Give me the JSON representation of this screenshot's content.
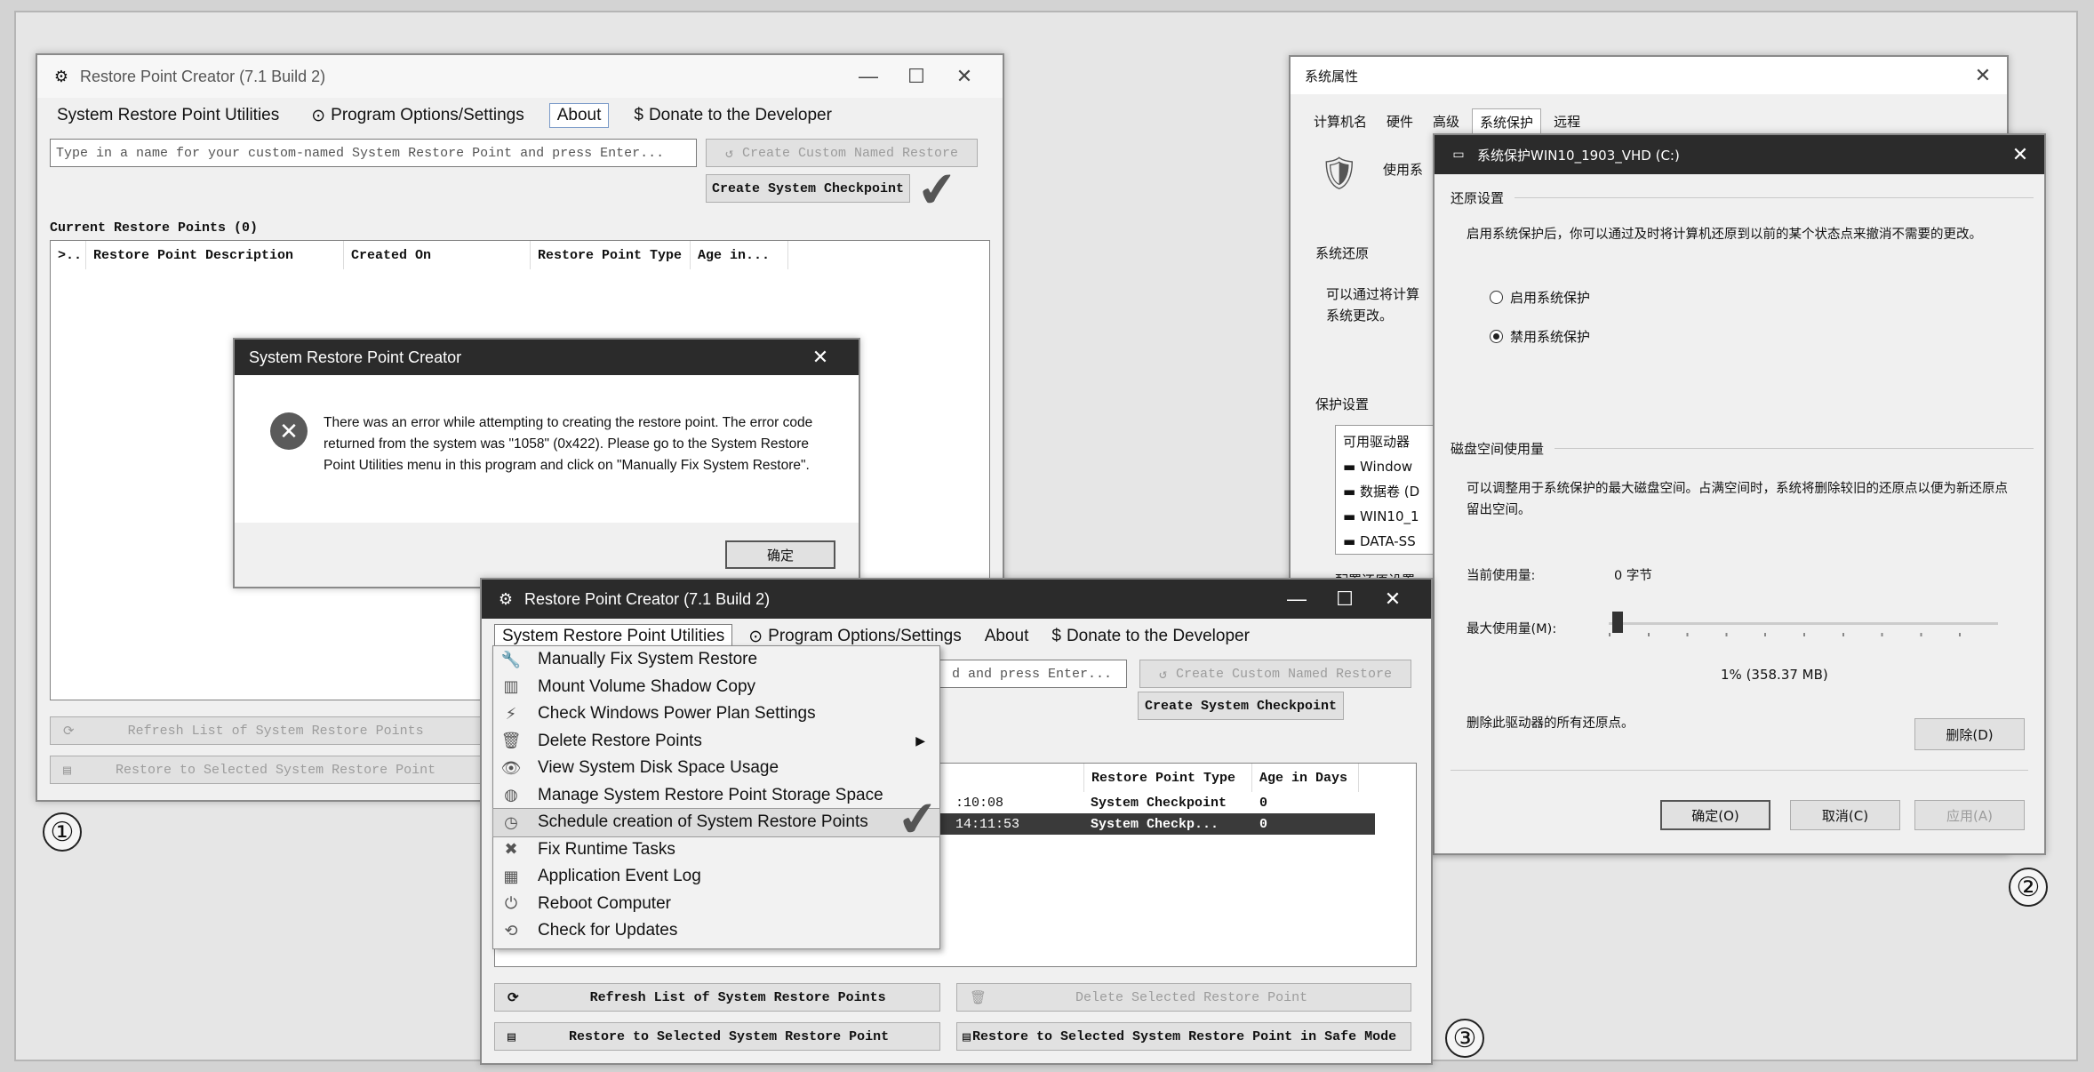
{
  "colors": {
    "background": "#d3d3d3",
    "titlebar_dark": "#2b2b2b",
    "selection": "#3a3a3a",
    "error_icon": "#5a5a5a"
  },
  "win1": {
    "title": "Restore Point Creator (7.1 Build 2)",
    "menu": [
      "System Restore Point Utilities",
      "Program Options/Settings",
      "About",
      "Donate to the Developer"
    ],
    "input_placeholder": "Type in a name for your custom-named System Restore Point and press Enter...",
    "btn_custom": "Create Custom Named Restore",
    "btn_checkpoint": "Create System Checkpoint",
    "current_label": "Current Restore Points (0)",
    "columns": [
      ">..",
      "Restore Point Description",
      "Created On",
      "Restore Point Type",
      "Age in..."
    ],
    "btn_refresh": "Refresh List of System Restore Points",
    "btn_restore": "Restore to Selected System Restore Point"
  },
  "dialog": {
    "title": "System Restore Point Creator",
    "message": "There was an error while attempting to creating the restore point. The error code returned from the system was \"1058\" (0x422). Please go to the System Restore Point Utilities menu in this program and click on \"Manually Fix System Restore\".",
    "ok": "确定"
  },
  "win2": {
    "title": "系统属性",
    "tabs": [
      "计算机名",
      "硬件",
      "高级",
      "系统保护",
      "远程"
    ],
    "partial_protect": "使用系",
    "section_restore": "系统还原",
    "restore_text": "可以通过将计算",
    "restore_text2": "系统更改。",
    "section_settings": "保护设置",
    "drives_header": "可用驱动器",
    "drives": [
      "Window",
      "数据卷 (D",
      "WIN10_1",
      "DATA-SS"
    ],
    "partial_bottom": "配置还原设置"
  },
  "win2b": {
    "title": "系统保护WIN10_1903_VHD (C:)",
    "section_restore": "还原设置",
    "restore_desc": "启用系统保护后，你可以通过及时将计算机还原到以前的某个状态点来撤消不需要的更改。",
    "radio_on": "启用系统保护",
    "radio_off": "禁用系统保护",
    "section_disk": "磁盘空间使用量",
    "disk_desc": "可以调整用于系统保护的最大磁盘空间。占满空间时，系统将删除较旧的还原点以便为新还原点留出空间。",
    "current_label": "当前使用量:",
    "current_value": "0 字节",
    "max_label": "最大使用量(M):",
    "slider_value": "1% (358.37 MB)",
    "slider_fraction": 0.01,
    "delete_text": "删除此驱动器的所有还原点。",
    "delete_btn": "删除(D)",
    "ok": "确定(O)",
    "cancel": "取消(C)",
    "apply": "应用(A)"
  },
  "win3": {
    "title": "Restore Point Creator (7.1 Build 2)",
    "menu": [
      "System Restore Point Utilities",
      "Program Options/Settings",
      "About",
      "Donate to the Developer"
    ],
    "input_partial": "d and press Enter...",
    "btn_custom": "Create Custom Named Restore",
    "btn_checkpoint": "Create System Checkpoint",
    "columns": [
      "Restore Point Type",
      "Age in Days"
    ],
    "rows": [
      {
        "time": ":10:08",
        "type": "System Checkpoint",
        "age": "0"
      },
      {
        "time": "14:11:53",
        "type": "System Checkp...",
        "age": "0"
      }
    ],
    "btn_refresh": "Refresh List of System Restore Points",
    "btn_delete": "Delete Selected Restore Point",
    "btn_restore": "Restore to Selected System Restore Point",
    "btn_restore_safe": "Restore to Selected System Restore Point in Safe Mode"
  },
  "dropdown": {
    "items": [
      {
        "label": "Manually Fix System Restore",
        "icon": "wrench-icon"
      },
      {
        "label": "Mount Volume Shadow Copy",
        "icon": "drive-icon"
      },
      {
        "label": "Check Windows Power Plan Settings",
        "icon": "plug-icon"
      },
      {
        "label": "Delete Restore Points",
        "icon": "trash-icon"
      },
      {
        "label": "View System Disk Space Usage",
        "icon": "eye-icon"
      },
      {
        "label": "Manage System Restore Point Storage Space",
        "icon": "disk-icon"
      },
      {
        "label": "Schedule creation of System Restore Points",
        "icon": "clock-icon"
      },
      {
        "label": "Fix Runtime Tasks",
        "icon": "tools-icon"
      },
      {
        "label": "Application Event Log",
        "icon": "log-icon"
      },
      {
        "label": "Reboot Computer",
        "icon": "power-icon"
      },
      {
        "label": "Check for Updates",
        "icon": "refresh-icon"
      }
    ]
  },
  "labels": {
    "one": "①",
    "two": "②",
    "three": "③"
  }
}
